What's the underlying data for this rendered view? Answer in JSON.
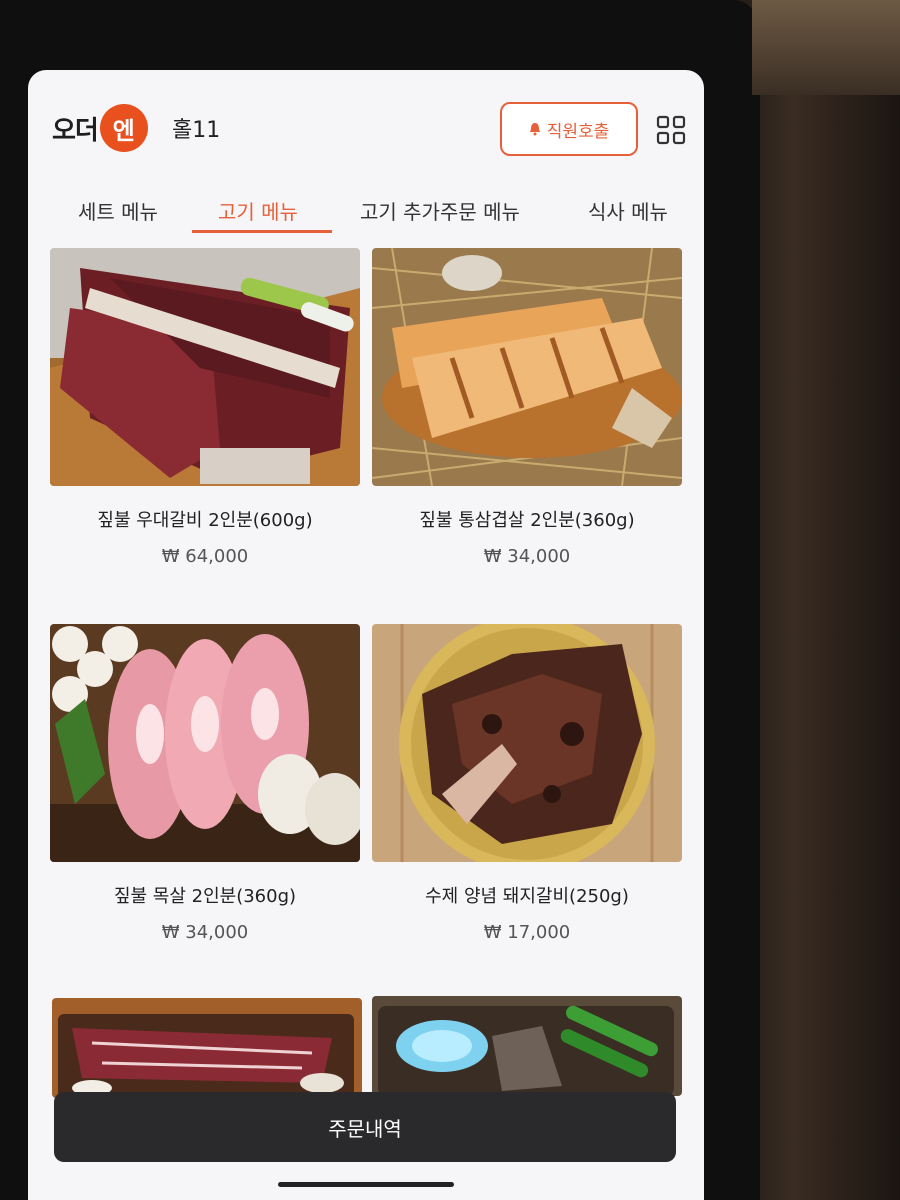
{
  "header": {
    "logo_part1": "오더",
    "logo_part2": "엔",
    "table_name": "홀11",
    "call_button": "직원호출"
  },
  "tabs": [
    {
      "label": "세트 메뉴",
      "active": false
    },
    {
      "label": "고기 메뉴",
      "active": true
    },
    {
      "label": "고기 추가주문 메뉴",
      "active": false
    },
    {
      "label": "식사 메뉴",
      "active": false
    }
  ],
  "menu": [
    {
      "name": "짚불 우대갈비 2인분(600g)",
      "price": "₩ 64,000"
    },
    {
      "name": "짚불 통삼겹살 2인분(360g)",
      "price": "₩ 34,000"
    },
    {
      "name": "짚불 목살 2인분(360g)",
      "price": "₩ 34,000"
    },
    {
      "name": "수제 양념 돼지갈비(250g)",
      "price": "₩ 17,000"
    },
    {
      "name": "",
      "price": ""
    },
    {
      "name": "",
      "price": ""
    }
  ],
  "order_button": "주문내역",
  "colors": {
    "accent": "#e6613a",
    "logo": "#e8501e",
    "bottom_bar": "#2a2a2c"
  }
}
